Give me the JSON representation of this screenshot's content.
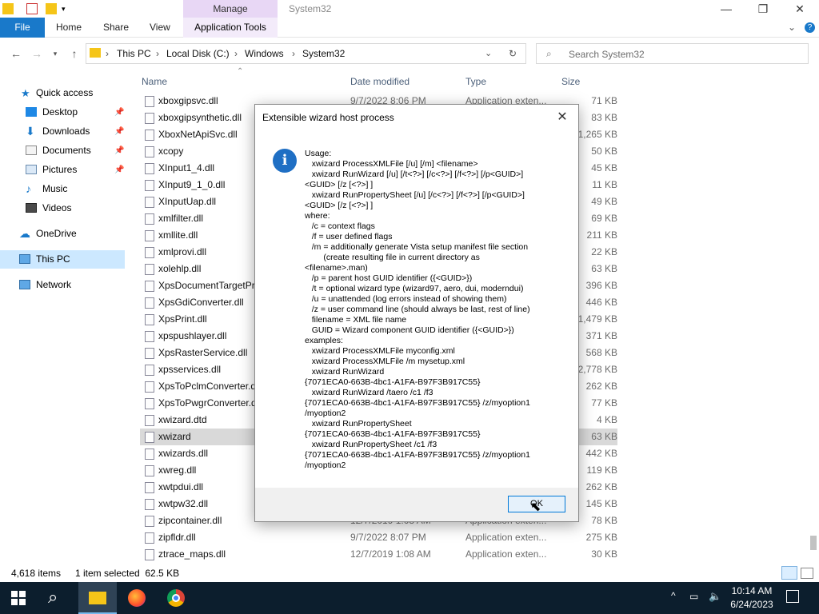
{
  "window": {
    "title": "System32",
    "manage_tab": "Manage",
    "minimize": "—",
    "maximize": "❐",
    "close": "✕"
  },
  "ribbon": {
    "file": "File",
    "home": "Home",
    "share": "Share",
    "view": "View",
    "app_tools": "Application Tools",
    "chevron": "⌄",
    "help": "?"
  },
  "address": {
    "crumbs": [
      "This PC",
      "Local Disk (C:)",
      "Windows",
      "System32"
    ],
    "search_placeholder": "Search System32"
  },
  "nav": {
    "items": [
      {
        "label": "Quick access"
      },
      {
        "label": "Desktop"
      },
      {
        "label": "Downloads"
      },
      {
        "label": "Documents"
      },
      {
        "label": "Pictures"
      },
      {
        "label": "Music"
      },
      {
        "label": "Videos"
      },
      {
        "label": "OneDrive"
      },
      {
        "label": "This PC"
      },
      {
        "label": "Network"
      }
    ]
  },
  "columns": {
    "name": "Name",
    "date": "Date modified",
    "type": "Type",
    "size": "Size"
  },
  "files": [
    {
      "name": "xboxgipsvc.dll",
      "date": "9/7/2022 8:06 PM",
      "type": "Application exten...",
      "size": "71 KB"
    },
    {
      "name": "xboxgipsynthetic.dll",
      "date": "",
      "type": "",
      "size": "83 KB"
    },
    {
      "name": "XboxNetApiSvc.dll",
      "date": "",
      "type": "",
      "size": "1,265 KB"
    },
    {
      "name": "xcopy",
      "date": "",
      "type": "",
      "size": "50 KB"
    },
    {
      "name": "XInput1_4.dll",
      "date": "",
      "type": "",
      "size": "45 KB"
    },
    {
      "name": "XInput9_1_0.dll",
      "date": "",
      "type": "",
      "size": "11 KB"
    },
    {
      "name": "XInputUap.dll",
      "date": "",
      "type": "",
      "size": "49 KB"
    },
    {
      "name": "xmlfilter.dll",
      "date": "",
      "type": "",
      "size": "69 KB"
    },
    {
      "name": "xmllite.dll",
      "date": "",
      "type": "",
      "size": "211 KB"
    },
    {
      "name": "xmlprovi.dll",
      "date": "",
      "type": "",
      "size": "22 KB"
    },
    {
      "name": "xolehlp.dll",
      "date": "",
      "type": "",
      "size": "63 KB"
    },
    {
      "name": "XpsDocumentTargetPri",
      "date": "",
      "type": "",
      "size": "396 KB"
    },
    {
      "name": "XpsGdiConverter.dll",
      "date": "",
      "type": "",
      "size": "446 KB"
    },
    {
      "name": "XpsPrint.dll",
      "date": "",
      "type": "",
      "size": "1,479 KB"
    },
    {
      "name": "xpspushlayer.dll",
      "date": "",
      "type": "",
      "size": "371 KB"
    },
    {
      "name": "XpsRasterService.dll",
      "date": "",
      "type": "",
      "size": "568 KB"
    },
    {
      "name": "xpsservices.dll",
      "date": "",
      "type": "",
      "size": "2,778 KB"
    },
    {
      "name": "XpsToPclmConverter.dl",
      "date": "",
      "type": "",
      "size": "262 KB"
    },
    {
      "name": "XpsToPwgrConverter.dl",
      "date": "",
      "type": "",
      "size": "77 KB"
    },
    {
      "name": "xwizard.dtd",
      "date": "",
      "type": "",
      "size": "4 KB"
    },
    {
      "name": "xwizard",
      "date": "",
      "type": "",
      "size": "63 KB"
    },
    {
      "name": "xwizards.dll",
      "date": "",
      "type": "",
      "size": "442 KB"
    },
    {
      "name": "xwreg.dll",
      "date": "",
      "type": "",
      "size": "119 KB"
    },
    {
      "name": "xwtpdui.dll",
      "date": "",
      "type": "",
      "size": "262 KB"
    },
    {
      "name": "xwtpw32.dll",
      "date": "",
      "type": "",
      "size": "145 KB"
    },
    {
      "name": "zipcontainer.dll",
      "date": "12/7/2019 1:08 AM",
      "type": "Application exten...",
      "size": "78 KB"
    },
    {
      "name": "zipfldr.dll",
      "date": "9/7/2022 8:07 PM",
      "type": "Application exten...",
      "size": "275 KB"
    },
    {
      "name": "ztrace_maps.dll",
      "date": "12/7/2019 1:08 AM",
      "type": "Application exten...",
      "size": "30 KB"
    }
  ],
  "status": {
    "count": "4,618 items",
    "selected": "1 item selected  62.5 KB"
  },
  "taskbar": {
    "time": "10:14 AM",
    "date": "6/24/2023"
  },
  "dialog": {
    "title": "Extensible wizard host process",
    "icon": "i",
    "ok": "OK",
    "text": "Usage:\n   xwizard ProcessXMLFile [/u] [/m] <filename>\n   xwizard RunWizard [/u] [/t<?>] [/c<?>] [/f<?>] [/p<GUID>]\n<GUID> [/z [<?>] ]\n   xwizard RunPropertySheet [/u] [/c<?>] [/f<?>] [/p<GUID>]\n<GUID> [/z [<?>] ]\nwhere:\n   /c = context flags\n   /f = user defined flags\n   /m = additionally generate Vista setup manifest file section\n        (create resulting file in current directory as\n<filename>.man)\n   /p = parent host GUID identifier ({<GUID>})\n   /t = optional wizard type (wizard97, aero, dui, moderndui)\n   /u = unattended (log errors instead of showing them)\n   /z = user command line (should always be last, rest of line)\n   filename = XML file name\n   GUID = Wizard component GUID identifier ({<GUID>})\nexamples:\n   xwizard ProcessXMLFile myconfig.xml\n   xwizard ProcessXMLFile /m mysetup.xml\n   xwizard RunWizard\n{7071ECA0-663B-4bc1-A1FA-B97F3B917C55}\n   xwizard RunWizard /taero /c1 /f3\n{7071ECA0-663B-4bc1-A1FA-B97F3B917C55} /z/myoption1\n/myoption2\n   xwizard RunPropertySheet\n{7071ECA0-663B-4bc1-A1FA-B97F3B917C55}\n   xwizard RunPropertySheet /c1 /f3\n{7071ECA0-663B-4bc1-A1FA-B97F3B917C55} /z/myoption1\n/myoption2"
  }
}
